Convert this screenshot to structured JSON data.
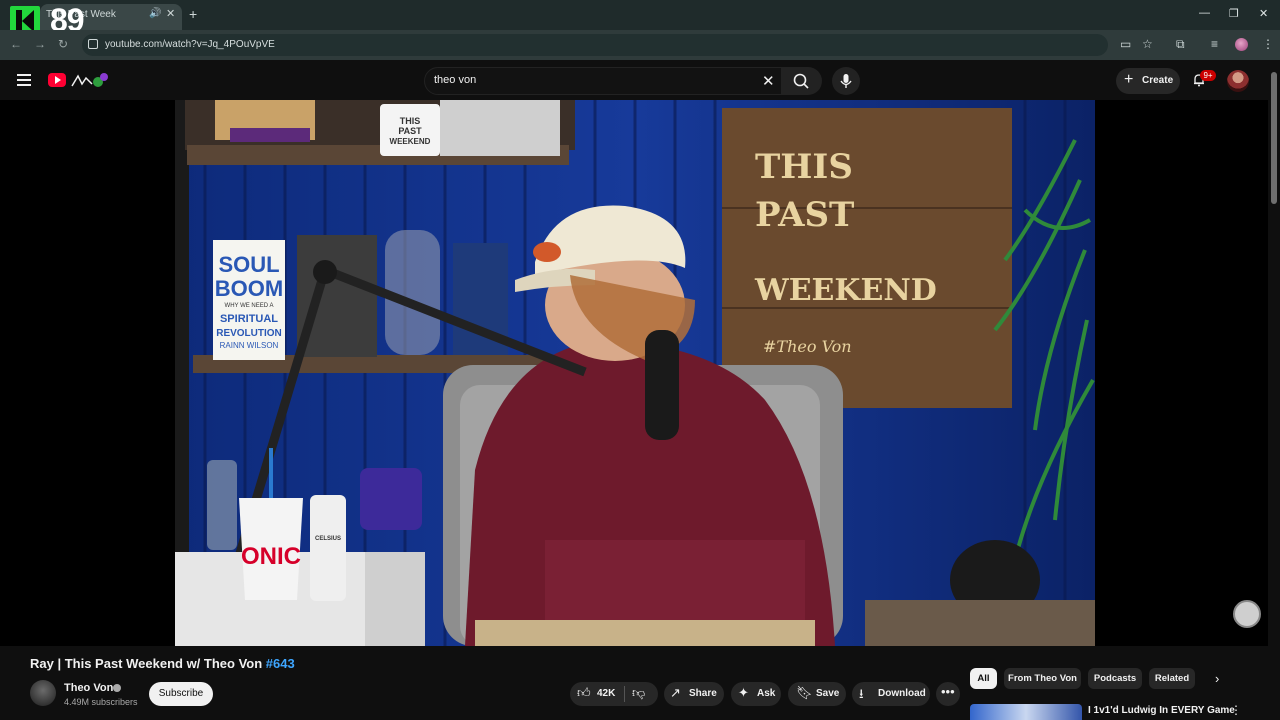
{
  "browser": {
    "tab_title": "This Past Week",
    "tab_audio_icon": "speaker-icon",
    "url": "youtube.com/watch?v=Jq_4POuVpVE",
    "window_controls": [
      "minimize",
      "restore",
      "close"
    ]
  },
  "overlay_logo": {
    "letter": "K",
    "number": "89",
    "color": "#22d63c"
  },
  "masthead": {
    "search_query": "theo von",
    "create_label": "Create",
    "notification_badge": "9+"
  },
  "video": {
    "title_main": "Ray | This Past Weekend w/ Theo Von ",
    "title_hashtag": "#643",
    "sign_text": [
      "THIS",
      "PAST",
      "WEEKEND",
      "#Theo Von"
    ],
    "book_text": [
      "SOUL",
      "BOOM",
      "WHY WE NEED A",
      "SPIRITUAL",
      "REVOLUTION",
      "RAINN WILSON"
    ],
    "mug_text": [
      "THIS",
      "PAST",
      "WEEKEND"
    ],
    "cup_text": "ONIC",
    "can_text": "CELSIUS"
  },
  "channel": {
    "name": "Theo Von",
    "subscribers": "4.49M subscribers",
    "subscribe_label": "Subscribe"
  },
  "actions": {
    "like_count": "42K",
    "share_label": "Share",
    "ask_label": "Ask",
    "save_label": "Save",
    "download_label": "Download"
  },
  "chips": [
    "All",
    "From Theo Von",
    "Podcasts",
    "Related"
  ],
  "related": {
    "first_title": "I 1v1'd Ludwig In EVERY Game"
  },
  "colors": {
    "accent_red": "#ff0033",
    "hashtag_blue": "#3ea6ff",
    "background": "#0f0f0f"
  }
}
